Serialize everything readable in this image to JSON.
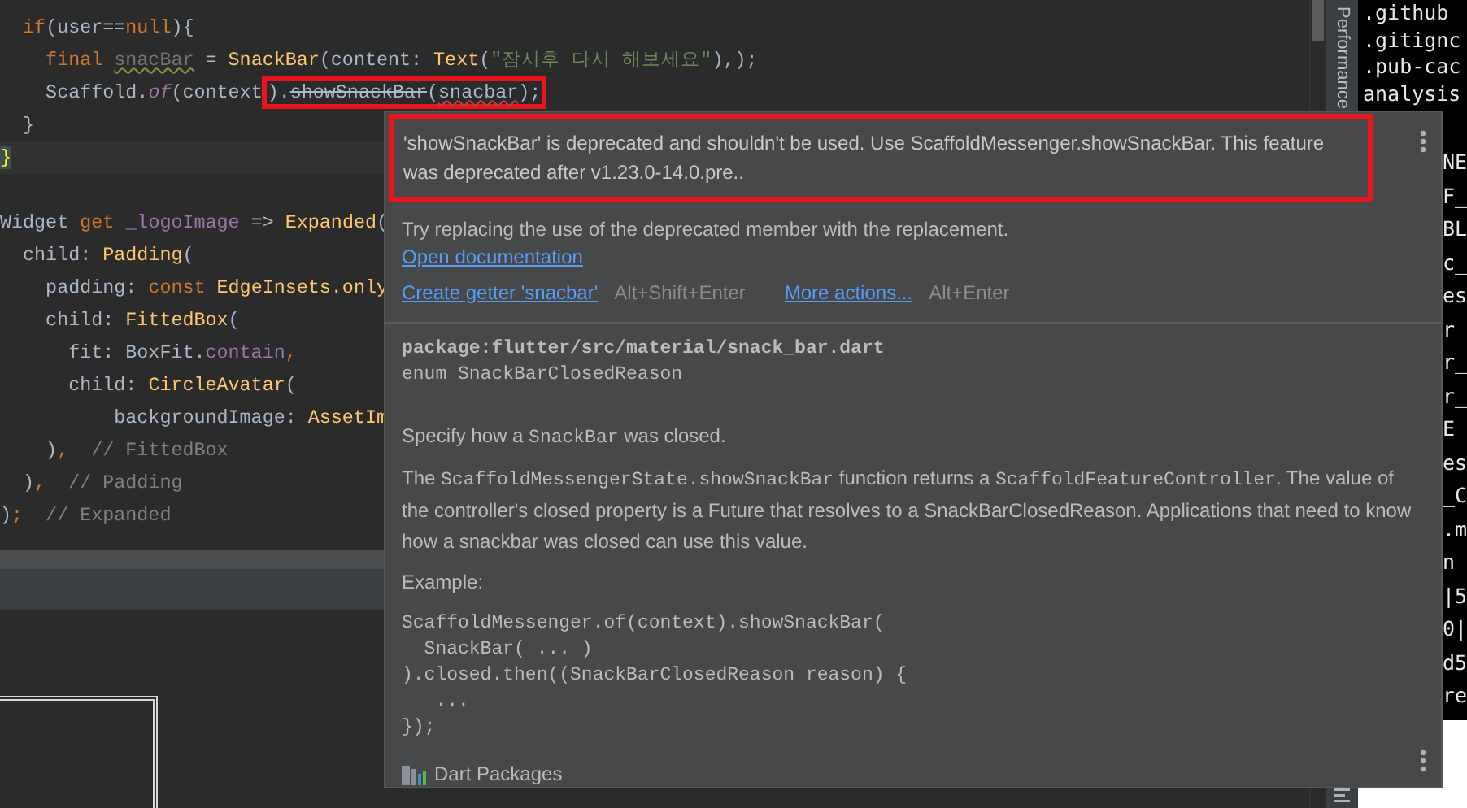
{
  "editor": {
    "lines": [
      {
        "current": false,
        "tokens": [
          {
            "text": "  if",
            "kind": "kw"
          },
          {
            "text": "(user==",
            "kind": "plain"
          },
          {
            "text": "null",
            "kind": "kw"
          },
          {
            "text": "){",
            "kind": "plain"
          }
        ]
      },
      {
        "current": false,
        "tokens": [
          {
            "text": "    final ",
            "kind": "kw"
          },
          {
            "text": "snacBar",
            "kind": "unused"
          },
          {
            "text": " = ",
            "kind": "plain"
          },
          {
            "text": "SnackBar",
            "kind": "cls"
          },
          {
            "text": "(content: ",
            "kind": "plain"
          },
          {
            "text": "Text",
            "kind": "cls"
          },
          {
            "text": "(",
            "kind": "plain"
          },
          {
            "text": "\"잠시후 다시 해보세요\"",
            "kind": "str"
          },
          {
            "text": "),);",
            "kind": "plain"
          }
        ]
      },
      {
        "current": false,
        "tokens": [
          {
            "text": "    Scaffold.",
            "kind": "plain"
          },
          {
            "text": "of",
            "kind": "static"
          },
          {
            "text": "(context",
            "kind": "plain"
          },
          {
            "text": ").",
            "kind": "plain",
            "boxed": true
          },
          {
            "text": "showSnackBar",
            "kind": "deprecated",
            "boxed": true
          },
          {
            "text": "(",
            "kind": "plain",
            "boxed": true
          },
          {
            "text": "snacbar",
            "kind": "error",
            "boxed": true
          },
          {
            "text": ");",
            "kind": "plain",
            "boxed": true
          }
        ]
      },
      {
        "current": false,
        "tokens": [
          {
            "text": "  }",
            "kind": "plain"
          }
        ]
      },
      {
        "current": true,
        "tokens": [
          {
            "text": "}",
            "kind": "brace"
          }
        ]
      },
      {
        "kind": "blank"
      },
      {
        "current": false,
        "tokens": [
          {
            "text": "Widget",
            "kind": "plain"
          },
          {
            "text": " get ",
            "kind": "kw"
          },
          {
            "text": "_logoImage",
            "kind": "prop"
          },
          {
            "text": " => ",
            "kind": "plain"
          },
          {
            "text": "Expanded",
            "kind": "cls"
          },
          {
            "text": "(",
            "kind": "plain"
          }
        ]
      },
      {
        "current": false,
        "tokens": [
          {
            "text": "  child: ",
            "kind": "plain"
          },
          {
            "text": "Padding",
            "kind": "cls"
          },
          {
            "text": "(",
            "kind": "plain"
          }
        ]
      },
      {
        "current": false,
        "tokens": [
          {
            "text": "    padding: ",
            "kind": "plain"
          },
          {
            "text": "const ",
            "kind": "kw"
          },
          {
            "text": "EdgeInsets.only",
            "kind": "cls"
          }
        ]
      },
      {
        "current": false,
        "tokens": [
          {
            "text": "    child: ",
            "kind": "plain"
          },
          {
            "text": "FittedBox",
            "kind": "cls"
          },
          {
            "text": "(",
            "kind": "plain"
          }
        ]
      },
      {
        "current": false,
        "tokens": [
          {
            "text": "      fit: BoxFit.",
            "kind": "plain"
          },
          {
            "text": "contain",
            "kind": "prop"
          },
          {
            "text": ",",
            "kind": "kw"
          }
        ]
      },
      {
        "current": false,
        "tokens": [
          {
            "text": "      child: ",
            "kind": "plain"
          },
          {
            "text": "CircleAvatar",
            "kind": "cls"
          },
          {
            "text": "(",
            "kind": "plain"
          }
        ]
      },
      {
        "current": false,
        "tokens": [
          {
            "text": "          backgroundImage: ",
            "kind": "plain"
          },
          {
            "text": "AssetIm",
            "kind": "cls"
          }
        ]
      },
      {
        "current": false,
        "tokens": [
          {
            "text": "    )",
            "kind": "plain"
          },
          {
            "text": ",",
            "kind": "kw"
          },
          {
            "text": "  // FittedBox",
            "kind": "comment"
          }
        ]
      },
      {
        "current": false,
        "tokens": [
          {
            "text": "  )",
            "kind": "plain"
          },
          {
            "text": ",",
            "kind": "kw"
          },
          {
            "text": "  // Padding",
            "kind": "comment"
          }
        ]
      },
      {
        "current": false,
        "tokens": [
          {
            "text": ")",
            "kind": "plain"
          },
          {
            "text": ";",
            "kind": "kw"
          },
          {
            "text": "  // Expanded",
            "kind": "comment"
          }
        ]
      }
    ]
  },
  "tool_stripe": {
    "label": "Performance"
  },
  "terminal": {
    "lines": [
      ".github",
      ".gitignc",
      ".pub-cac",
      "analysis"
    ],
    "fragments": [
      "NE",
      "F_",
      "BL",
      "c_",
      "es",
      "r",
      "r_",
      "r_",
      "E",
      "es",
      "_C",
      ".m",
      "n",
      "|5",
      "0|",
      "d5",
      "re"
    ]
  },
  "popup": {
    "message": "'showSnackBar' is deprecated and shouldn't be used. Use ScaffoldMessenger.showSnackBar. This feature was deprecated after v1.23.0-14.0.pre..",
    "hint": "Try replacing the use of the deprecated member with the replacement.",
    "doc_link": "Open documentation",
    "actions": [
      {
        "label": "Create getter 'snacbar'",
        "shortcut": "Alt+Shift+Enter"
      },
      {
        "label": "More actions...",
        "shortcut": "Alt+Enter"
      }
    ],
    "doc": {
      "package": "package:flutter/src/material/snack_bar.dart",
      "signature": "enum SnackBarClosedReason",
      "paragraphs": [
        [
          {
            "text": "Specify how a ",
            "code": false
          },
          {
            "text": "SnackBar",
            "code": true
          },
          {
            "text": " was closed.",
            "code": false
          }
        ],
        [
          {
            "text": "The ",
            "code": false
          },
          {
            "text": "ScaffoldMessengerState.showSnackBar",
            "code": true
          },
          {
            "text": " function returns a ",
            "code": false
          },
          {
            "text": "ScaffoldFeatureController",
            "code": true
          },
          {
            "text": ". The value of the controller's closed property is a Future that resolves to a SnackBarClosedReason. Applications that need to know how a snackbar was closed can use this value.",
            "code": false
          }
        ]
      ],
      "example_label": "Example:",
      "example_code": [
        "ScaffoldMessenger.of(context).showSnackBar(",
        "  SnackBar( ... )",
        ").closed.then((SnackBarClosedReason reason) {",
        "   ...",
        "});"
      ],
      "source": "Dart Packages"
    }
  }
}
